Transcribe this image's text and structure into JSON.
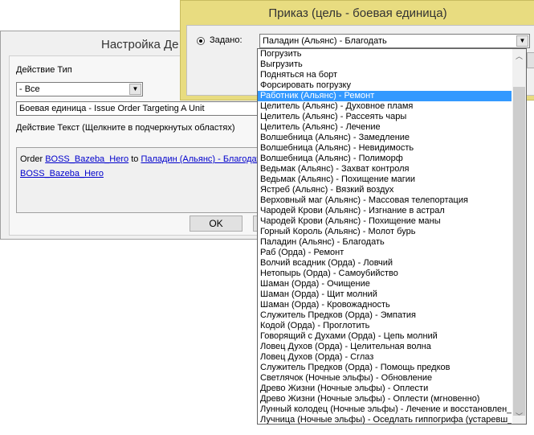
{
  "back_dialog": {
    "title": "Настройка Де",
    "action_type_label": "Действие Тип",
    "action_type_value": "- Все",
    "action_value": "Боевая единица - Issue Order Targeting A Unit",
    "action_text_label": "Действие Текст (Щелкните в подчеркнутых областях)",
    "text_order": "Order",
    "text_link1": "BOSS_Bazeba_Hero",
    "text_to": "to",
    "text_link2": "Паладин (Альянс) - Благодать",
    "text_link3": "BOSS_Bazeba_Hero",
    "ok_label": "OK"
  },
  "front_dialog": {
    "title": "Приказ (цель - боевая единица)",
    "radio_label": "Задано:",
    "selected_value": "Паладин (Альянс) - Благодать",
    "highlighted_index": 4,
    "options": [
      "Погрузить",
      "Выгрузить",
      "Подняться на борт",
      "Форсировать погрузку",
      "Работник (Альянс) - Ремонт",
      "Целитель (Альянс) - Духовное пламя",
      "Целитель (Альянс) - Рассеять чары",
      "Целитель (Альянс) - Лечение",
      "Волшебница (Альянс) - Замедление",
      "Волшебница (Альянс) - Невидимость",
      "Волшебница (Альянс) - Полиморф",
      "Ведьмак (Альянс) - Захват контроля",
      "Ведьмак (Альянс) - Похищение магии",
      "Ястреб (Альянс) - Вязкий воздух",
      "Верховный маг (Альянс) - Массовая телепортация",
      "Чародей Крови (Альянс) - Изгнание в астрал",
      "Чародей Крови (Альянс) - Похищение маны",
      "Горный Король (Альянс) - Молот бурь",
      "Паладин (Альянс) - Благодать",
      "Раб (Орда) - Ремонт",
      "Волчий всадник (Орда) - Ловчий",
      "Нетопырь (Орда) - Самоубийство",
      "Шаман (Орда) - Очищение",
      "Шаман (Орда) - Щит молний",
      "Шаман (Орда) - Кровожадность",
      "Служитель Предков (Орда) - Эмпатия",
      "Кодой (Орда) - Проглотить",
      "Говорящий с Духами (Орда) - Цепь молний",
      "Ловец Духов (Орда) - Целительная волна",
      "Ловец Духов (Орда) - Сглаз",
      "Служитель Предков (Орда) - Помощь предков",
      "Светлячок (Ночные эльфы) - Обновление",
      "Древо Жизни (Ночные эльфы) - Оплести",
      "Древо Жизни (Ночные эльфы) - Оплести (мгновенно)",
      "Лунный колодец (Ночные эльфы) - Лечение и восстановлен_",
      "Лучница (Ночные эльфы) - Оседлать гиппогрифа (устаревш_"
    ]
  }
}
